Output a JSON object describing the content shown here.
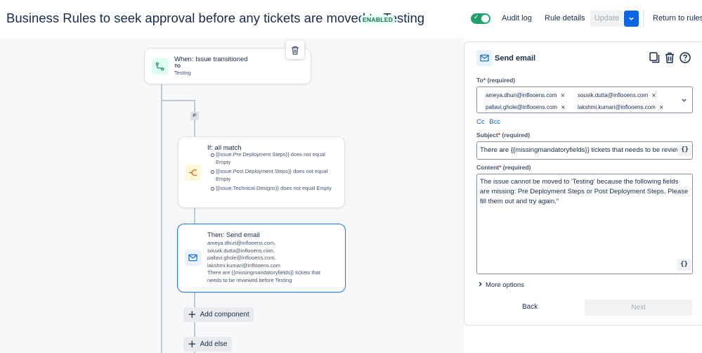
{
  "header": {
    "title": "Business Rules to seek approval before any tickets are moved to Testing",
    "status_badge": "ENABLED",
    "audit_log": "Audit log",
    "rule_details": "Rule details",
    "update": "Update",
    "return_to_rules": "Return to rules",
    "toggle_on": true
  },
  "canvas": {
    "trigger": {
      "title": "When: Issue transitioned",
      "to_label": "TO",
      "to_value": "Testing"
    },
    "if_pill": "IF",
    "condition": {
      "title": "If: all match",
      "items": [
        "{{issue.Pre Deployment Steps}} does not equal Empty",
        "{{issue.Post Deployment Steps}} does not equal Empty",
        "{{issue.Technical Designs}} does not equal Empty"
      ]
    },
    "action": {
      "title": "Then: Send email",
      "lines": [
        "ameya.dhuri@inflooens.com,",
        "souvik.dutta@inflooens.com,",
        "pallavi.ghole@inflooens.com,",
        "lakshmi.kumari@inflooens.com",
        "There are {{missingmandatoryfields}} tickets that",
        "needs to be reviewed before Testing"
      ]
    },
    "add_component": "Add component",
    "add_else": "Add else"
  },
  "panel": {
    "title": "Send email",
    "to_label": "To",
    "to_required": "(required)",
    "recipients": [
      "ameya.dhuri@inflooens.com",
      "souvik.dutta@inflooens.com",
      "pallavi.ghole@inflooens.com",
      "lakshmi.kumari@inflooens.com"
    ],
    "cc": "Cc",
    "bcc": "Bcc",
    "subject_label": "Subject",
    "subject_required": "(required)",
    "subject_value": "There are {{missingmandatoryfields}} tickets that needs to be reviewed before Testing",
    "content_label": "Content",
    "content_required": "(required)",
    "content_value": "The issue cannot be moved to 'Testing' because the following fields are missing: Pre Deployment Steps or Post Deployment Steps. Please fill them out and try again.\"",
    "braces": "{}",
    "more_options": "More options",
    "back": "Back",
    "next": "Next"
  },
  "colors": {
    "accent": "#0C66E4",
    "toggle": "#22A06B",
    "selected_border": "#1D7AFC",
    "required": "#C9372C"
  }
}
